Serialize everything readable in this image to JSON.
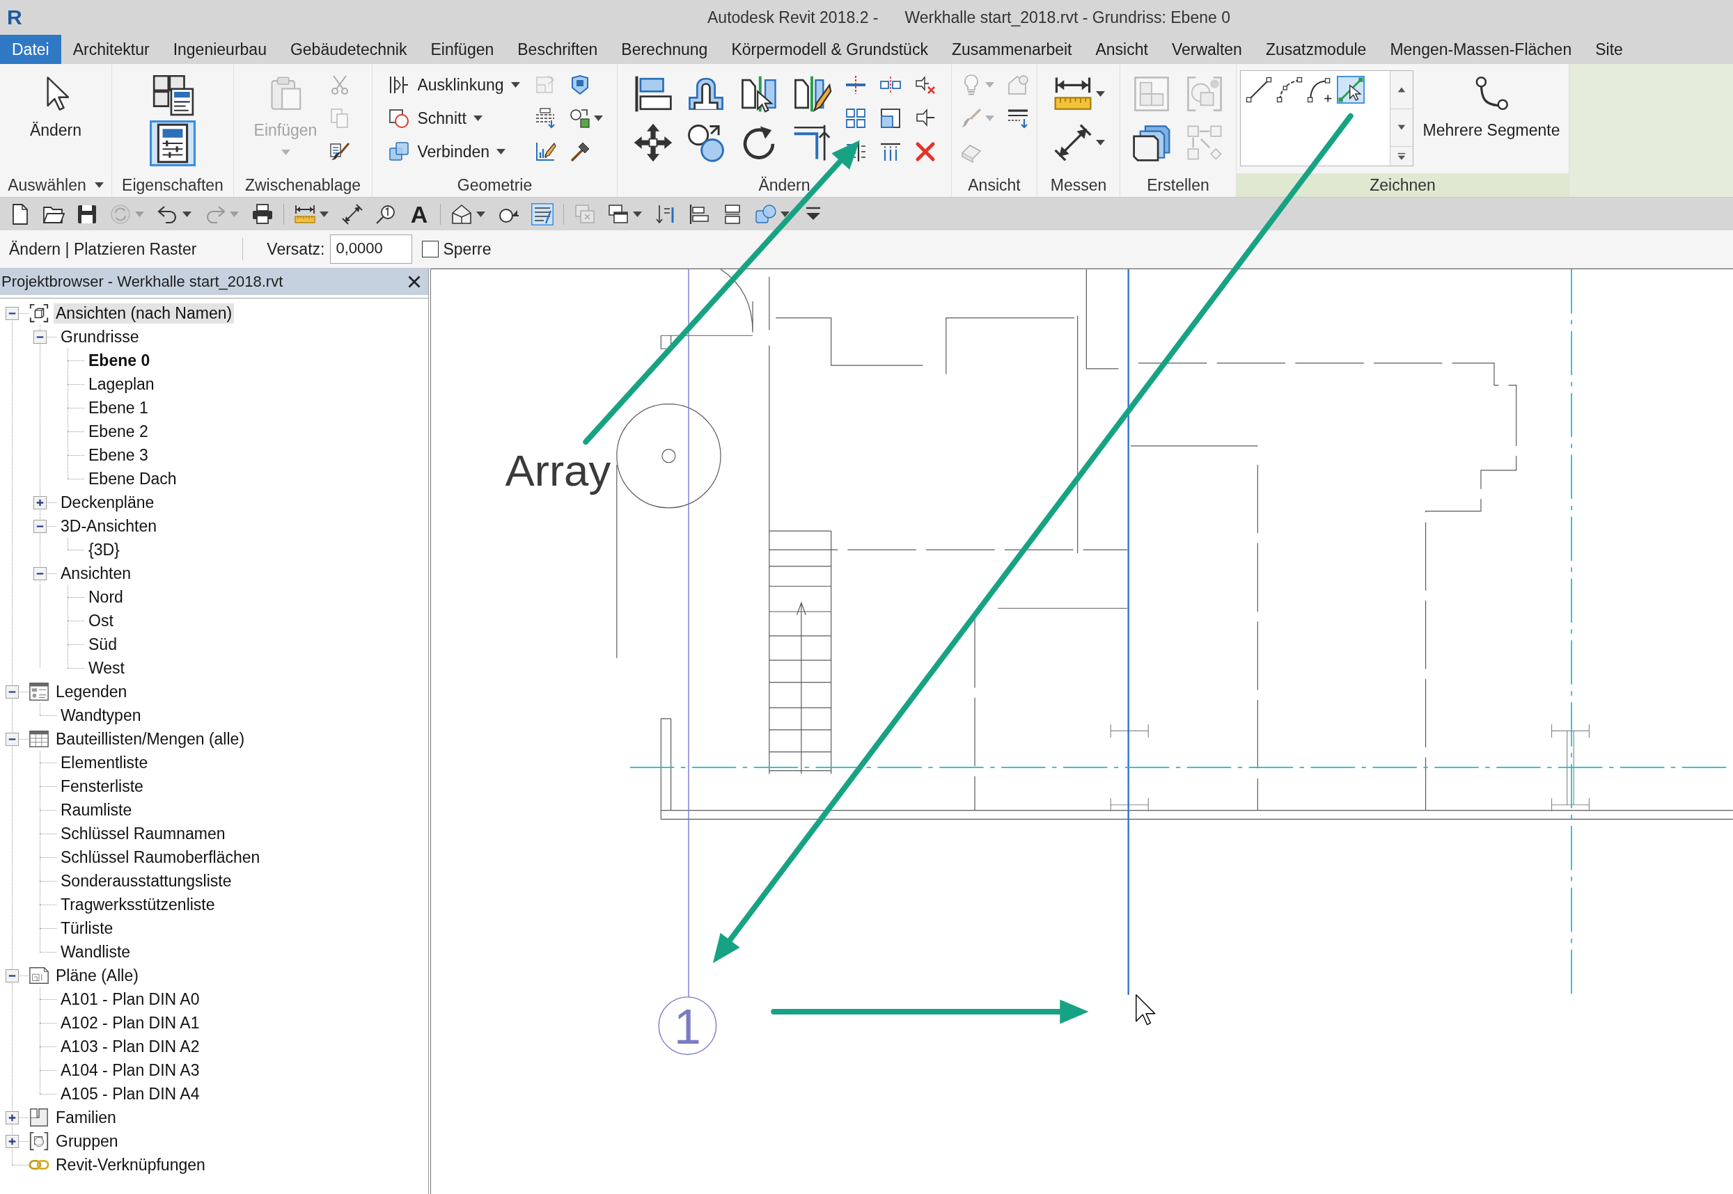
{
  "window": {
    "logo": "R",
    "title": "Autodesk Revit 2018.2 -",
    "document": "Werkhalle start_2018.rvt - Grundriss: Ebene 0"
  },
  "ribbon_tabs": [
    {
      "label": "Datei",
      "kind": "file"
    },
    {
      "label": "Architektur",
      "kind": "tab"
    },
    {
      "label": "Ingenieurbau",
      "kind": "tab"
    },
    {
      "label": "Gebäudetechnik",
      "kind": "tab"
    },
    {
      "label": "Einfügen",
      "kind": "tab"
    },
    {
      "label": "Beschriften",
      "kind": "tab"
    },
    {
      "label": "Berechnung",
      "kind": "tab"
    },
    {
      "label": "Körpermodell & Grundstück",
      "kind": "tab"
    },
    {
      "label": "Zusammenarbeit",
      "kind": "tab"
    },
    {
      "label": "Ansicht",
      "kind": "tab"
    },
    {
      "label": "Verwalten",
      "kind": "tab"
    },
    {
      "label": "Zusatzmodule",
      "kind": "tab"
    },
    {
      "label": "Mengen-Massen-Flächen",
      "kind": "tab"
    },
    {
      "label": "Site",
      "kind": "tab"
    }
  ],
  "ribbon": {
    "panels": [
      {
        "label": "Auswählen",
        "dropdown": true,
        "contextual": false,
        "columns": [
          {
            "kind": "large",
            "items": [
              {
                "kind": "cursor",
                "label": "Ändern",
                "disabled": false,
                "dropdown": false
              }
            ]
          }
        ]
      },
      {
        "label": "Eigenschaften",
        "dropdown": false,
        "contextual": false,
        "columns": [
          {
            "kind": "stack",
            "items": [
              {
                "kind": "type-properties",
                "disabled": false,
                "on": false
              },
              {
                "kind": "properties",
                "disabled": false,
                "on": true
              }
            ]
          }
        ]
      },
      {
        "label": "Zwischenablage",
        "dropdown": false,
        "contextual": false,
        "columns": [
          {
            "kind": "large",
            "items": [
              {
                "kind": "paste",
                "label": "Einfügen",
                "disabled": true,
                "dropdown": true
              }
            ]
          },
          {
            "kind": "small",
            "items": [
              {
                "kind": "cut",
                "disabled": true,
                "dropdown": false
              },
              {
                "kind": "copy",
                "disabled": true,
                "dropdown": false
              },
              {
                "kind": "match",
                "disabled": false,
                "dropdown": false
              }
            ]
          }
        ]
      },
      {
        "label": "Geometrie",
        "dropdown": false,
        "contextual": false,
        "columns": [
          {
            "kind": "small",
            "items": [
              {
                "kind": "cope",
                "label": "Ausklinkung",
                "disabled": false,
                "dropdown": true
              },
              {
                "kind": "cut-geometry",
                "label": "Schnitt",
                "disabled": false,
                "dropdown": true
              },
              {
                "kind": "join",
                "label": "Verbinden",
                "disabled": false,
                "dropdown": true
              }
            ]
          },
          {
            "kind": "small",
            "items": [
              {
                "kind": "wall-joins",
                "disabled": true,
                "dropdown": false
              },
              {
                "kind": "split-face",
                "disabled": false,
                "dropdown": false
              },
              {
                "kind": "paint",
                "disabled": false,
                "dropdown": false
              }
            ]
          },
          {
            "kind": "small",
            "items": [
              {
                "kind": "wall-face",
                "disabled": false,
                "dropdown": false
              },
              {
                "kind": "shape-swap",
                "disabled": false,
                "dropdown": true
              },
              {
                "kind": "hammer",
                "disabled": false,
                "dropdown": false
              }
            ]
          }
        ]
      },
      {
        "label": "Ändern",
        "dropdown": false,
        "contextual": false,
        "columns": [
          {
            "kind": "medium",
            "items": [
              {
                "kind": "align",
                "disabled": false,
                "dropdown": false
              },
              {
                "kind": "move",
                "disabled": false,
                "dropdown": false
              }
            ]
          },
          {
            "kind": "medium",
            "items": [
              {
                "kind": "offset",
                "disabled": false,
                "dropdown": false
              },
              {
                "kind": "copy-element",
                "disabled": false,
                "dropdown": false
              }
            ]
          },
          {
            "kind": "medium",
            "items": [
              {
                "kind": "mirror-pick",
                "disabled": false,
                "dropdown": false
              },
              {
                "kind": "rotate",
                "disabled": false,
                "dropdown": false
              }
            ]
          },
          {
            "kind": "medium",
            "items": [
              {
                "kind": "mirror-draw",
                "disabled": false,
                "dropdown": false
              },
              {
                "kind": "trim",
                "disabled": false,
                "dropdown": false
              }
            ]
          },
          {
            "kind": "small",
            "items": [
              {
                "kind": "split",
                "disabled": false,
                "dropdown": false
              },
              {
                "kind": "array",
                "disabled": false,
                "dropdown": false
              },
              {
                "kind": "trim-multi",
                "disabled": false,
                "dropdown": false
              }
            ]
          },
          {
            "kind": "small",
            "items": [
              {
                "kind": "split-gap",
                "disabled": false,
                "dropdown": false
              },
              {
                "kind": "scale",
                "disabled": false,
                "dropdown": false
              },
              {
                "kind": "extend",
                "disabled": false,
                "dropdown": false
              }
            ]
          },
          {
            "kind": "small",
            "items": [
              {
                "kind": "unpin",
                "disabled": false,
                "dropdown": false
              },
              {
                "kind": "pin",
                "disabled": false,
                "dropdown": false
              },
              {
                "kind": "delete",
                "disabled": false,
                "dropdown": false
              }
            ]
          }
        ]
      },
      {
        "label": "Ansicht",
        "dropdown": false,
        "contextual": false,
        "columns": [
          {
            "kind": "small",
            "items": [
              {
                "kind": "bulb",
                "disabled": true,
                "dropdown": true
              },
              {
                "kind": "brush",
                "disabled": true,
                "dropdown": true
              },
              {
                "kind": "eraser",
                "disabled": true,
                "dropdown": false
              }
            ]
          },
          {
            "kind": "small",
            "items": [
              {
                "kind": "override",
                "disabled": true,
                "dropdown": false
              },
              {
                "kind": "line-weights",
                "disabled": false,
                "dropdown": false
              }
            ]
          }
        ]
      },
      {
        "label": "Messen",
        "dropdown": false,
        "contextual": false,
        "columns": [
          {
            "kind": "medium",
            "items": [
              {
                "kind": "measure",
                "disabled": false,
                "dropdown": true
              },
              {
                "kind": "dimension",
                "disabled": false,
                "dropdown": true
              }
            ]
          }
        ]
      },
      {
        "label": "Erstellen",
        "dropdown": false,
        "contextual": false,
        "columns": [
          {
            "kind": "medium",
            "items": [
              {
                "kind": "group",
                "disabled": true,
                "dropdown": false
              },
              {
                "kind": "parts",
                "disabled": false,
                "dropdown": false
              }
            ]
          },
          {
            "kind": "medium",
            "items": [
              {
                "kind": "similar",
                "disabled": true,
                "dropdown": false
              },
              {
                "kind": "assembly",
                "disabled": true,
                "dropdown": false
              }
            ]
          }
        ]
      },
      {
        "label": "Zeichnen",
        "dropdown": false,
        "contextual": true,
        "columns": [
          {
            "kind": "gallery",
            "items": [
              {
                "kind": "line",
                "selected": false
              },
              {
                "kind": "curved-line",
                "selected": false
              },
              {
                "kind": "arc",
                "selected": false
              },
              {
                "kind": "pick-line",
                "selected": true
              }
            ]
          },
          {
            "kind": "large",
            "items": [
              {
                "kind": "spline",
                "label": "Mehrere Segmente",
                "disabled": false,
                "dropdown": false
              }
            ]
          }
        ]
      }
    ]
  },
  "quick_access": {
    "groups": [
      [
        {
          "kind": "new",
          "disabled": false,
          "on": false,
          "dropdown": false
        },
        {
          "kind": "open",
          "disabled": false,
          "on": false,
          "dropdown": false
        },
        {
          "kind": "save",
          "disabled": false,
          "on": false,
          "dropdown": false
        },
        {
          "kind": "sync",
          "disabled": true,
          "on": false,
          "dropdown": true
        },
        {
          "kind": "undo",
          "disabled": false,
          "on": false,
          "dropdown": true
        },
        {
          "kind": "redo",
          "disabled": true,
          "on": false,
          "dropdown": true
        },
        {
          "kind": "print",
          "disabled": false,
          "on": false,
          "dropdown": false
        }
      ],
      [
        {
          "kind": "measure",
          "disabled": false,
          "on": false,
          "dropdown": true
        },
        {
          "kind": "dimension",
          "disabled": false,
          "on": false,
          "dropdown": false
        },
        {
          "kind": "tag",
          "disabled": false,
          "on": false,
          "dropdown": false
        },
        {
          "kind": "text",
          "label": "A",
          "disabled": false,
          "on": false,
          "dropdown": false
        }
      ],
      [
        {
          "kind": "house",
          "disabled": false,
          "on": false,
          "dropdown": true
        },
        {
          "kind": "section",
          "disabled": false,
          "on": false,
          "dropdown": false
        },
        {
          "kind": "thin-lines",
          "disabled": false,
          "on": true,
          "dropdown": false
        }
      ],
      [
        {
          "kind": "close-windows",
          "disabled": true,
          "on": false,
          "dropdown": false
        },
        {
          "kind": "switch-windows",
          "disabled": false,
          "on": false,
          "dropdown": true
        },
        {
          "kind": "arrow-bars",
          "disabled": false,
          "on": false,
          "dropdown": false
        },
        {
          "kind": "align-left",
          "disabled": false,
          "on": false,
          "dropdown": false
        },
        {
          "kind": "stack",
          "disabled": false,
          "on": false,
          "dropdown": false
        },
        {
          "kind": "shapes",
          "disabled": false,
          "on": false,
          "dropdown": true
        },
        {
          "kind": "customize",
          "disabled": false,
          "on": false,
          "dropdown": false
        }
      ]
    ]
  },
  "options_bar": {
    "context": "Ändern | Platzieren Raster",
    "offset": {
      "label": "Versatz:",
      "value": "0,0000"
    },
    "lock": {
      "label": "Sperre",
      "checked": false
    }
  },
  "project_browser": {
    "title": "Projektbrowser - Werkhalle start_2018.rvt",
    "tree": [
      {
        "label": "Ansichten (nach Namen)",
        "kind": "views",
        "expanded": true,
        "selected": true,
        "current": false,
        "children": [
          {
            "label": "Grundrisse",
            "expanded": true,
            "selected": false,
            "current": false,
            "children": [
              {
                "label": "Ebene 0",
                "selected": false,
                "current": true
              },
              {
                "label": "Lageplan",
                "selected": false,
                "current": false
              },
              {
                "label": "Ebene 1",
                "selected": false,
                "current": false
              },
              {
                "label": "Ebene 2",
                "selected": false,
                "current": false
              },
              {
                "label": "Ebene 3",
                "selected": false,
                "current": false
              },
              {
                "label": "Ebene Dach",
                "selected": false,
                "current": false
              }
            ]
          },
          {
            "label": "Deckenpläne",
            "expanded": false,
            "selected": false,
            "current": false
          },
          {
            "label": "3D-Ansichten",
            "expanded": true,
            "selected": false,
            "current": false,
            "children": [
              {
                "label": "{3D}",
                "selected": false,
                "current": false
              }
            ]
          },
          {
            "label": "Ansichten",
            "expanded": true,
            "selected": false,
            "current": false,
            "children": [
              {
                "label": "Nord",
                "selected": false,
                "current": false
              },
              {
                "label": "Ost",
                "selected": false,
                "current": false
              },
              {
                "label": "Süd",
                "selected": false,
                "current": false
              },
              {
                "label": "West",
                "selected": false,
                "current": false
              }
            ]
          }
        ]
      },
      {
        "label": "Legenden",
        "kind": "legends",
        "expanded": true,
        "selected": false,
        "current": false,
        "children": [
          {
            "label": "Wandtypen",
            "selected": false,
            "current": false
          }
        ]
      },
      {
        "label": "Bauteillisten/Mengen (alle)",
        "kind": "schedules",
        "expanded": true,
        "selected": false,
        "current": false,
        "children": [
          {
            "label": "Elementliste",
            "selected": false,
            "current": false
          },
          {
            "label": "Fensterliste",
            "selected": false,
            "current": false
          },
          {
            "label": "Raumliste",
            "selected": false,
            "current": false
          },
          {
            "label": "Schlüssel Raumnamen",
            "selected": false,
            "current": false
          },
          {
            "label": "Schlüssel Raumoberflächen",
            "selected": false,
            "current": false
          },
          {
            "label": "Sonderausstattungsliste",
            "selected": false,
            "current": false
          },
          {
            "label": "Tragwerksstützenliste",
            "selected": false,
            "current": false
          },
          {
            "label": "Türliste",
            "selected": false,
            "current": false
          },
          {
            "label": "Wandliste",
            "selected": false,
            "current": false
          }
        ]
      },
      {
        "label": "Pläne (Alle)",
        "kind": "sheets",
        "expanded": true,
        "selected": false,
        "current": false,
        "children": [
          {
            "label": "A101 - Plan DIN A0",
            "selected": false,
            "current": false
          },
          {
            "label": "A102 - Plan DIN A1",
            "selected": false,
            "current": false
          },
          {
            "label": "A103 - Plan DIN A2",
            "selected": false,
            "current": false
          },
          {
            "label": "A104 - Plan DIN A3",
            "selected": false,
            "current": false
          },
          {
            "label": "A105 - Plan DIN A4",
            "selected": false,
            "current": false
          }
        ]
      },
      {
        "label": "Familien",
        "kind": "families",
        "expanded": false,
        "selected": false,
        "current": false
      },
      {
        "label": "Gruppen",
        "kind": "groups",
        "expanded": false,
        "selected": false,
        "current": false
      },
      {
        "label": "Revit-Verknüpfungen",
        "kind": "links",
        "selected": false,
        "current": false
      }
    ]
  },
  "canvas": {
    "annotation": "Array",
    "grid_label": "1"
  }
}
